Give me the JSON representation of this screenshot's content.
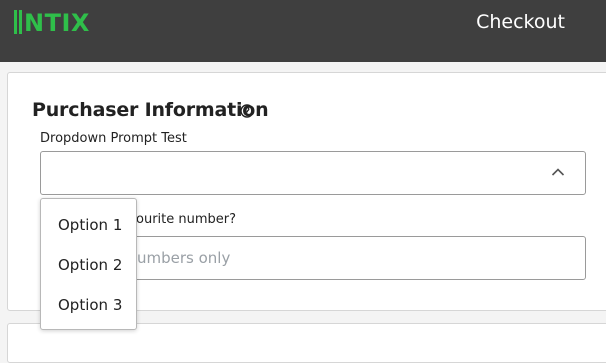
{
  "header": {
    "logo_text": "INTIX",
    "title": "Checkout",
    "colors": {
      "background": "#3f3f3f",
      "logo_green": "#2fbf4a"
    }
  },
  "purchaser": {
    "section_title": "Purchaser Information",
    "help_icon": "question-circle-icon",
    "dropdown_label": "Dropdown Prompt Test",
    "dropdown_value": "",
    "dropdown_options": [
      "Option 1",
      "Option 2",
      "Option 3"
    ],
    "number_label": "ourite number?",
    "number_placeholder": "umbers only",
    "number_value": ""
  }
}
